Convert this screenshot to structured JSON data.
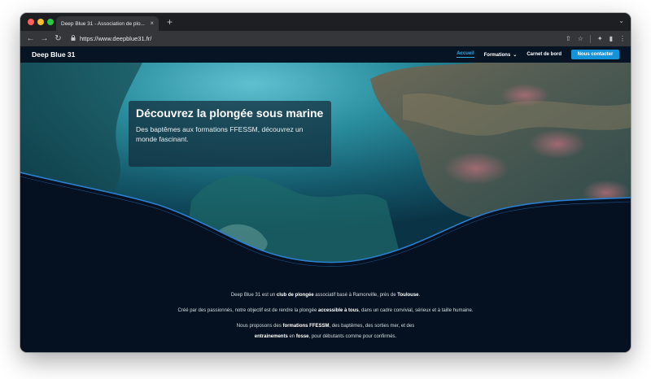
{
  "browser": {
    "tab_title": "Deep Blue 31 - Association de plo...",
    "tab_close": "×",
    "new_tab": "+",
    "tab_menu": "⌄",
    "url": "https://www.deepblue31.fr/",
    "back": "←",
    "forward": "→",
    "reload": "↻",
    "lock": "🔒",
    "share": "⇧",
    "bookmark": "☆",
    "extensions": "✦",
    "sidepanel": "▮",
    "menu": "⋮",
    "icon_names": [
      "back-icon",
      "forward-icon",
      "reload-icon",
      "lock-icon",
      "share-icon",
      "star-icon",
      "puzzle-icon",
      "sidepanel-icon",
      "kebab-icon"
    ]
  },
  "site": {
    "brand": "Deep Blue 31",
    "nav": {
      "home": "Accueil",
      "formations": "Formations",
      "formations_chevron": "⌄",
      "logbook": "Carnet de bord",
      "contact": "Nous contacter"
    },
    "hero": {
      "title": "Découvrez la plongée sous marine",
      "subtitle": "Des baptêmes aux formations FFESSM, découvrez un monde fascinant."
    },
    "intro": {
      "p1": {
        "t1": "Deep Blue 31 est un ",
        "b1": "club de plongée",
        "t2": " associatif basé à Ramonville, près de ",
        "b2": "Toulouse",
        "t3": "."
      },
      "p2": {
        "t1": "Créé par des passionnés, notre objectif est de rendre la plongée ",
        "b1": "accessible à tous",
        "t2": ", dans un cadre convivial, sérieux et à taille humaine."
      },
      "p3": {
        "t1": "Nous proposons des ",
        "b1": "formations FFESSM",
        "t2": ", des baptêmes, des sorties mer, et des ",
        "b2": "entrainements",
        "t3": " en ",
        "b3": "fosse",
        "t4": ", pour débutants comme pour confirmés."
      }
    },
    "colors": {
      "accent": "#1593d8",
      "nav_active": "#36a8e0",
      "page_bg": "#051120",
      "wave_line": "#2b7fd0"
    }
  }
}
